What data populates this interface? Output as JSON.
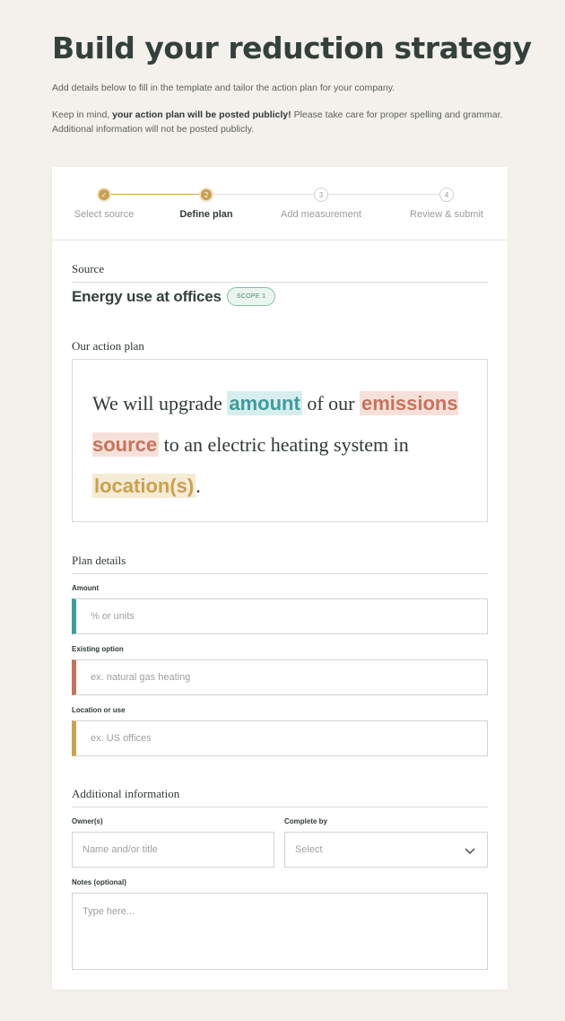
{
  "page": {
    "title": "Build your reduction strategy",
    "intro1": "Add details below to fill in the template and tailor the action plan for your company.",
    "intro2_prefix": "Keep in mind, ",
    "intro2_bold": "your action plan will be posted publicly!",
    "intro2_suffix": " Please take care for proper spelling and grammar. Additional information will not be posted publicly."
  },
  "stepper": {
    "steps": [
      {
        "label": "Select source",
        "number": "✓",
        "state": "done"
      },
      {
        "label": "Define plan",
        "number": "2",
        "state": "active"
      },
      {
        "label": "Add measurement",
        "number": "3",
        "state": "todo"
      },
      {
        "label": "Review & submit",
        "number": "4",
        "state": "todo"
      }
    ]
  },
  "source": {
    "heading": "Source",
    "name": "Energy use at offices",
    "badge": "SCOPE 1"
  },
  "action_plan": {
    "heading": "Our action plan",
    "text1": "We will upgrade ",
    "token_amount": "amount",
    "text2": " of our ",
    "token_source": "emissions source",
    "text3": " to an electric heating system in ",
    "token_location": "location(s)",
    "text4": "."
  },
  "plan_details": {
    "heading": "Plan details",
    "amount_label": "Amount",
    "amount_placeholder": "% or units",
    "existing_label": "Existing option",
    "existing_placeholder": "ex. natural gas heating",
    "location_label": "Location or use",
    "location_placeholder": "ex. US offices"
  },
  "additional": {
    "heading": "Additional information",
    "owner_label": "Owner(s)",
    "owner_placeholder": "Name and/or title",
    "complete_label": "Complete by",
    "complete_value": "Select",
    "notes_label": "Notes (optional)",
    "notes_placeholder": "Type here..."
  },
  "colors": {
    "amount": "#3e9c9e",
    "emissions_source": "#c6725c",
    "location": "#c9a14f",
    "scope_badge": "#4d8b6b"
  }
}
